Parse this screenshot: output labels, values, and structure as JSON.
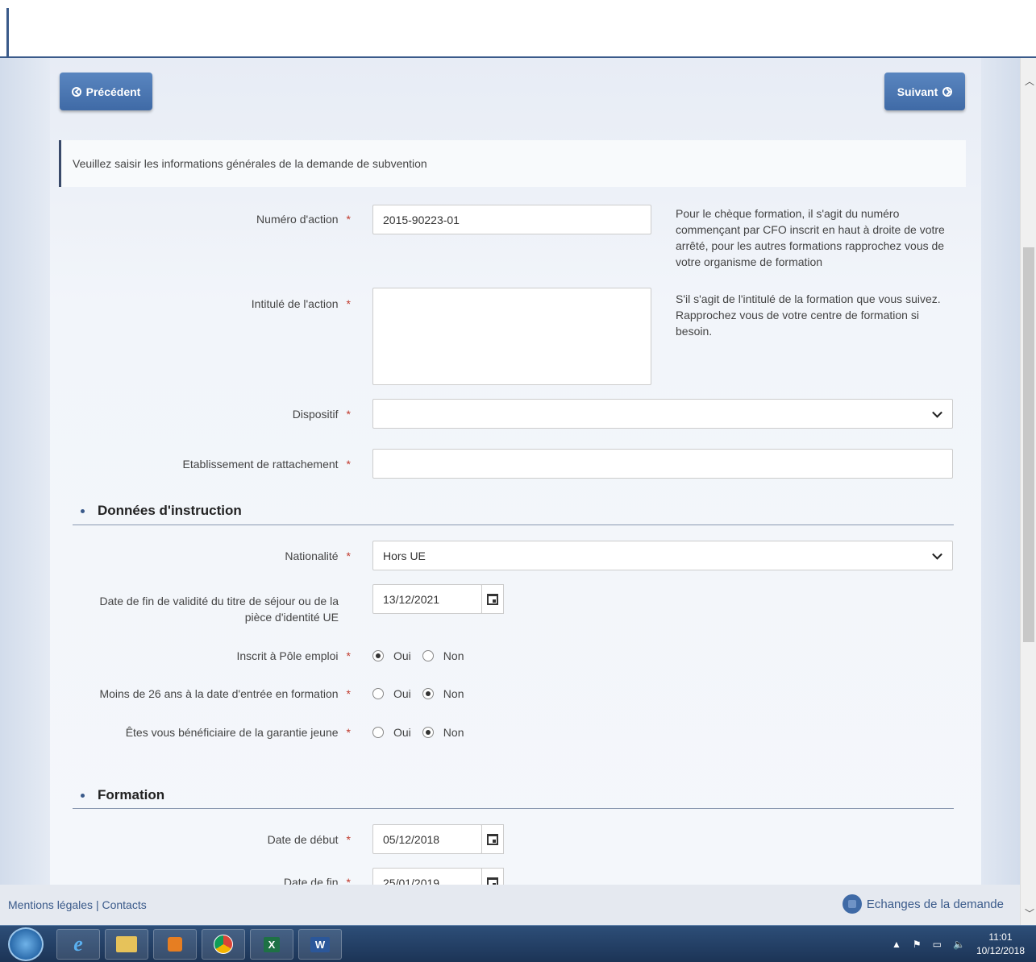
{
  "nav": {
    "prev_label": "Précédent",
    "next_label": "Suivant"
  },
  "info": "Veuillez saisir les informations générales de la demande de subvention",
  "fields": {
    "numero": {
      "label": "Numéro d'action",
      "value": "2015-90223-01",
      "help": "Pour le chèque formation, il s'agit du numéro commençant par CFO inscrit en haut à droite de votre arrêté, pour les autres formations rapprochez vous de votre organisme de formation"
    },
    "intitule": {
      "label": "Intitulé de l'action",
      "value": "",
      "help": "S'il s'agit de l'intitulé de la formation que vous suivez. Rapprochez vous de votre centre de formation si besoin."
    },
    "dispositif": {
      "label": "Dispositif",
      "value": ""
    },
    "etablissement": {
      "label": "Etablissement de rattachement",
      "value": ""
    }
  },
  "section1": {
    "title": "Données d'instruction",
    "nationalite": {
      "label": "Nationalité",
      "value": "Hors UE"
    },
    "date_validite": {
      "label": "Date de fin de validité du titre de séjour ou de la pièce d'identité UE",
      "value": "13/12/2021"
    },
    "pole_emploi": {
      "label": "Inscrit à Pôle emploi",
      "oui": "Oui",
      "non": "Non",
      "selected": "Oui"
    },
    "moins26": {
      "label": "Moins de 26 ans à la date d'entrée en formation",
      "oui": "Oui",
      "non": "Non",
      "selected": "Non"
    },
    "garantie": {
      "label": "Êtes vous bénéficiaire de la garantie jeune",
      "oui": "Oui",
      "non": "Non",
      "selected": "Non"
    }
  },
  "section2": {
    "title": "Formation",
    "date_debut": {
      "label": "Date de début",
      "value": "05/12/2018"
    },
    "date_fin": {
      "label": "Date de fin",
      "value": "25/01/2019"
    }
  },
  "footer": {
    "links": "Mentions légales | Contacts",
    "chat": "Echanges de la demande"
  },
  "taskbar": {
    "excel": "X",
    "word": "W",
    "time": "11:01",
    "date": "10/12/2018"
  },
  "colors": {
    "primary": "#3f6aa6",
    "required": "#c0392b"
  }
}
